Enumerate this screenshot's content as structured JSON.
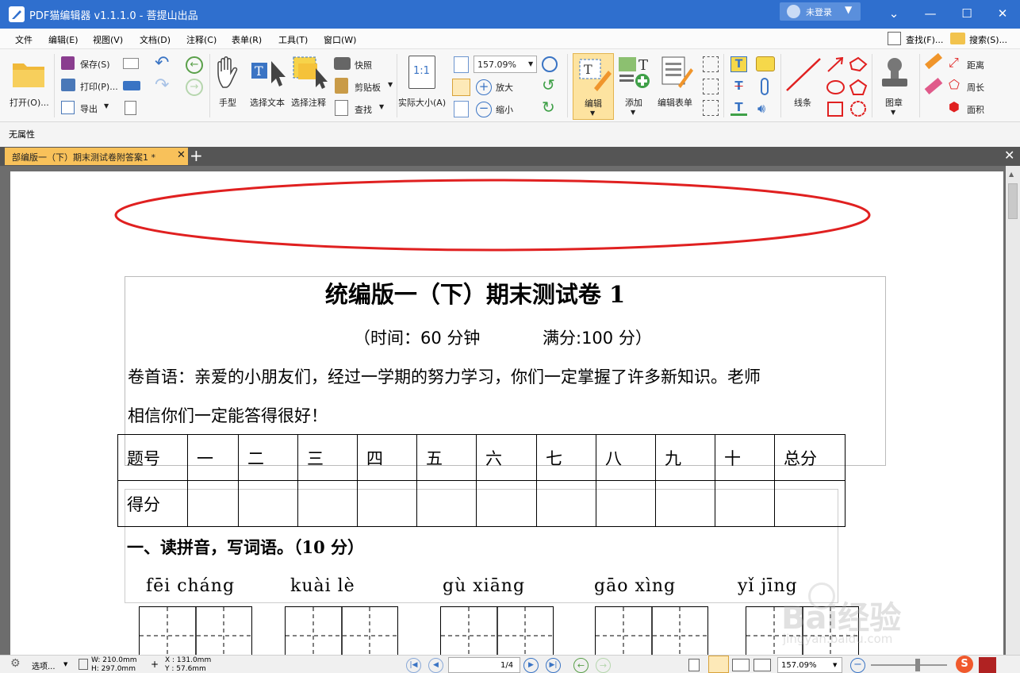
{
  "app": {
    "title": "PDF猫编辑器 v1.1.1.0 - 菩提山出品",
    "login": "未登录"
  },
  "menu": [
    "文件",
    "编辑(E)",
    "视图(V)",
    "文档(D)",
    "注释(C)",
    "表单(R)",
    "工具(T)",
    "窗口(W)"
  ],
  "menu_right": {
    "find": "查找(F)...",
    "search": "搜索(S)..."
  },
  "ribbon": {
    "open": "打开(O)...",
    "save": "保存(S)",
    "print": "打印(P)...",
    "export": "导出",
    "hand": "手型",
    "select_text": "选择文本",
    "select_annot": "选择注释",
    "snapshot": "快照",
    "clipboard": "剪贴板",
    "find": "查找",
    "actual_size": "实际大小(A)",
    "zoom_value": "157.09%",
    "zoom_in": "放大",
    "zoom_out": "缩小",
    "edit": "编辑",
    "add": "添加",
    "edit_form": "编辑表单",
    "lines": "线条",
    "stamp": "图章",
    "distance": "距离",
    "perimeter": "周长",
    "area": "面积"
  },
  "property_bar": "无属性",
  "tab": {
    "title": "部编版一（下）期末测试卷附答案1 *"
  },
  "doc": {
    "title": "统编版一（下）期末测试卷 1",
    "time": "（时间：60 分钟",
    "score": "满分:100 分）",
    "intro1": "卷首语：亲爱的小朋友们，经过一学期的努力学习，你们一定掌握了许多新知识。老师",
    "intro2": "相信你们一定能答得很好！",
    "table_header": [
      "题号",
      "一",
      "二",
      "三",
      "四",
      "五",
      "六",
      "七",
      "八",
      "九",
      "十",
      "总分"
    ],
    "table_row2_label": "得分",
    "section1": "一、读拼音，写词语。（10 分）",
    "pinyin": [
      "fēi cháng",
      "kuài lè",
      "gù xiāng",
      "gāo xìng",
      "yǐ jīng"
    ]
  },
  "status": {
    "options": "选项...",
    "width": "W: 210.0mm",
    "height": "H: 297.0mm",
    "x": "X : 131.0mm",
    "y": "Y :   57.6mm",
    "page": "1/4",
    "zoom": "157.09%"
  },
  "watermark": {
    "text": "Bai经验",
    "url": "jingyan.baidu.com"
  },
  "colors": {
    "titlebar": "#2f6fce",
    "tab": "#f8c15a",
    "ellipse": "#e02020"
  }
}
